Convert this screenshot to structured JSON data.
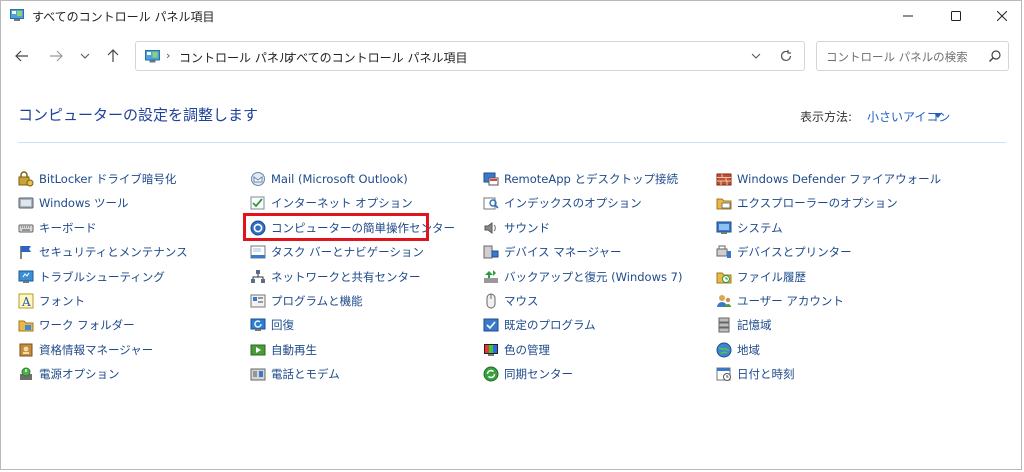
{
  "window": {
    "title": "すべてのコントロール パネル項目"
  },
  "address": {
    "crumbs": [
      "コントロール パネル",
      "すべてのコントロール パネル項目"
    ]
  },
  "search": {
    "placeholder": "コントロール パネルの検索"
  },
  "header": {
    "title": "コンピューターの設定を調整します",
    "view_label": "表示方法:",
    "view_value": "小さいアイコン"
  },
  "items": [
    {
      "label": "BitLocker ドライブ暗号化",
      "icon": "bitlocker-icon"
    },
    {
      "label": "Windows ツール",
      "icon": "windows-tools-icon"
    },
    {
      "label": "キーボード",
      "icon": "keyboard-icon"
    },
    {
      "label": "セキュリティとメンテナンス",
      "icon": "flag-icon"
    },
    {
      "label": "トラブルシューティング",
      "icon": "troubleshoot-icon"
    },
    {
      "label": "フォント",
      "icon": "font-icon"
    },
    {
      "label": "ワーク フォルダー",
      "icon": "work-folders-icon"
    },
    {
      "label": "資格情報マネージャー",
      "icon": "credential-manager-icon"
    },
    {
      "label": "電源オプション",
      "icon": "power-options-icon"
    },
    {
      "label": "Mail (Microsoft Outlook)",
      "icon": "mail-icon"
    },
    {
      "label": "インターネット オプション",
      "icon": "internet-options-icon"
    },
    {
      "label": "コンピューターの簡単操作センター",
      "icon": "ease-of-access-icon"
    },
    {
      "label": "タスク バーとナビゲーション",
      "icon": "taskbar-icon"
    },
    {
      "label": "ネットワークと共有センター",
      "icon": "network-icon"
    },
    {
      "label": "プログラムと機能",
      "icon": "programs-icon"
    },
    {
      "label": "回復",
      "icon": "recovery-icon"
    },
    {
      "label": "自動再生",
      "icon": "autoplay-icon"
    },
    {
      "label": "電話とモデム",
      "icon": "phone-modem-icon"
    },
    {
      "label": "RemoteApp とデスクトップ接続",
      "icon": "remoteapp-icon"
    },
    {
      "label": "インデックスのオプション",
      "icon": "indexing-icon"
    },
    {
      "label": "サウンド",
      "icon": "sound-icon"
    },
    {
      "label": "デバイス マネージャー",
      "icon": "device-manager-icon"
    },
    {
      "label": "バックアップと復元 (Windows 7)",
      "icon": "backup-icon"
    },
    {
      "label": "マウス",
      "icon": "mouse-icon"
    },
    {
      "label": "既定のプログラム",
      "icon": "default-programs-icon"
    },
    {
      "label": "色の管理",
      "icon": "color-management-icon"
    },
    {
      "label": "同期センター",
      "icon": "sync-center-icon"
    },
    {
      "label": "Windows Defender ファイアウォール",
      "icon": "firewall-icon"
    },
    {
      "label": "エクスプローラーのオプション",
      "icon": "explorer-options-icon"
    },
    {
      "label": "システム",
      "icon": "system-icon"
    },
    {
      "label": "デバイスとプリンター",
      "icon": "devices-printers-icon"
    },
    {
      "label": "ファイル履歴",
      "icon": "file-history-icon"
    },
    {
      "label": "ユーザー アカウント",
      "icon": "user-accounts-icon"
    },
    {
      "label": "記憶域",
      "icon": "storage-icon"
    },
    {
      "label": "地域",
      "icon": "region-icon"
    },
    {
      "label": "日付と時刻",
      "icon": "date-time-icon"
    }
  ],
  "colors": {
    "title": "#1e3f9a",
    "link": "#1e4a8a",
    "accent": "#1f5fbf",
    "highlight": "#e0141c"
  }
}
